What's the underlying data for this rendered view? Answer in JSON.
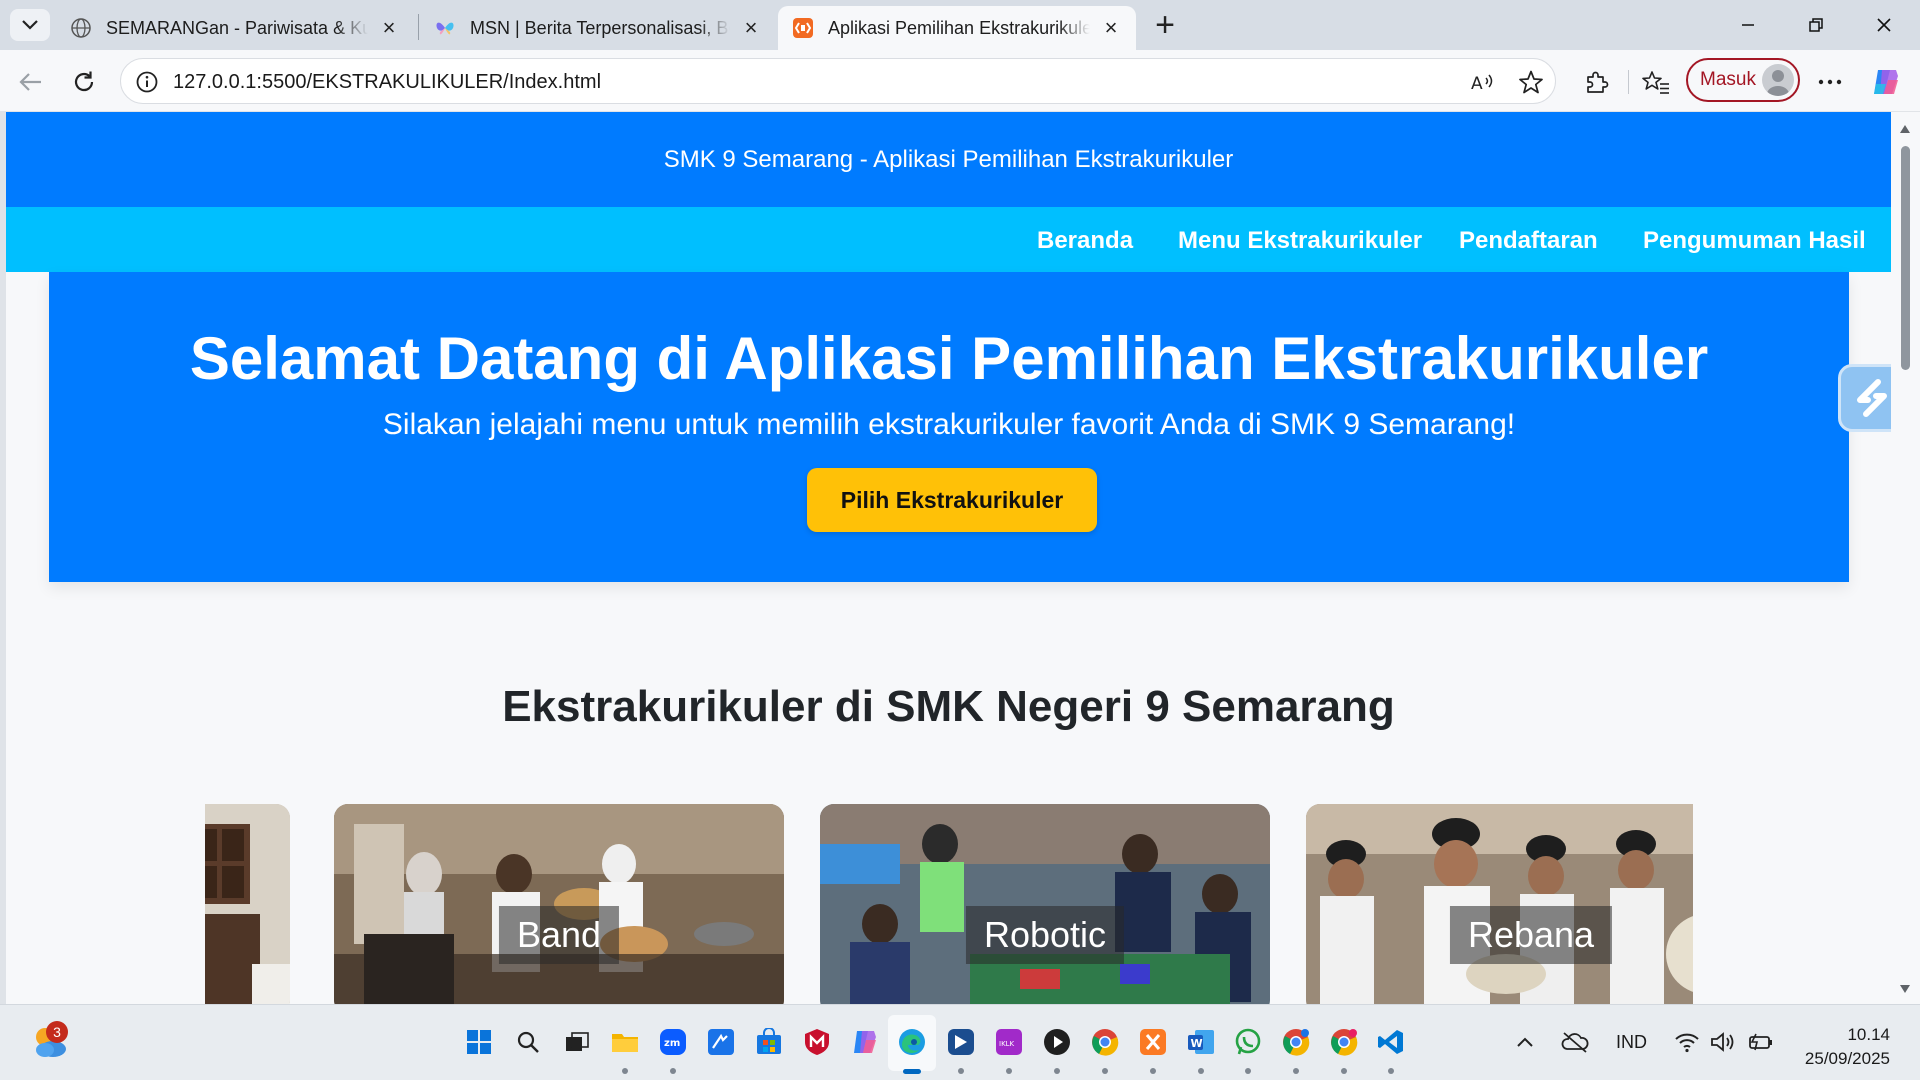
{
  "browser": {
    "tabs": [
      {
        "title": "SEMARANGan - Pariwisata & Kuliner",
        "favicon": "globe-icon",
        "active": false
      },
      {
        "title": "MSN | Berita Terpersonalisasi, Berita Terkini",
        "favicon": "msn-butterfly-icon",
        "active": false
      },
      {
        "title": "Aplikasi Pemilihan Ekstrakurikuler",
        "favicon": "html-live-server-icon",
        "active": true
      }
    ],
    "url": "127.0.0.1:5500/EKSTRAKULIKULER/Index.html",
    "signin_label": "Masuk",
    "accent": "#a31624"
  },
  "site": {
    "header_title": "SMK 9 Semarang - Aplikasi Pemilihan Ekstrakurikuler",
    "nav": [
      "Beranda",
      "Menu Ekstrakurikuler",
      "Pendaftaran",
      "Pengumuman Hasil"
    ],
    "hero": {
      "title": "Selamat Datang di Aplikasi Pemilihan Ekstrakurikuler",
      "subtitle": "Silakan jelajahi menu untuk memilih ekstrakurikuler favorit Anda di SMK 9 Semarang!",
      "cta_label": "Pilih Ekstrakurikuler"
    },
    "section_title": "Ekstrakurikuler di SMK Negeri 9 Semarang",
    "cards": [
      {
        "label": "",
        "photo": "partial-room-photo"
      },
      {
        "label": "Band",
        "photo": "band-practice-photo"
      },
      {
        "label": "Robotic",
        "photo": "robotics-students-photo"
      },
      {
        "label": "Rebana",
        "photo": "rebana-performers-photo"
      }
    ],
    "colors": {
      "header": "#007bff",
      "nav": "#00bfff",
      "cta": "#ffc107",
      "page_bg": "#f7f8fa"
    }
  },
  "taskbar": {
    "weather_badge": "3",
    "apps": [
      "start-icon",
      "search-icon",
      "task-view-icon",
      "file-explorer-icon",
      "zoom-icon",
      "app-blue-icon",
      "store-icon",
      "mcafee-icon",
      "copilot-icon",
      "edge-icon",
      "capcut-icon",
      "app-purple-icon",
      "media-player-icon",
      "chrome-icon",
      "xampp-icon",
      "word-icon",
      "whatsapp-icon",
      "chrome-profile-icon",
      "chrome-profile-2-icon",
      "vscode-icon"
    ],
    "language": "IND",
    "time": "10.14",
    "date": "25/09/2025"
  }
}
